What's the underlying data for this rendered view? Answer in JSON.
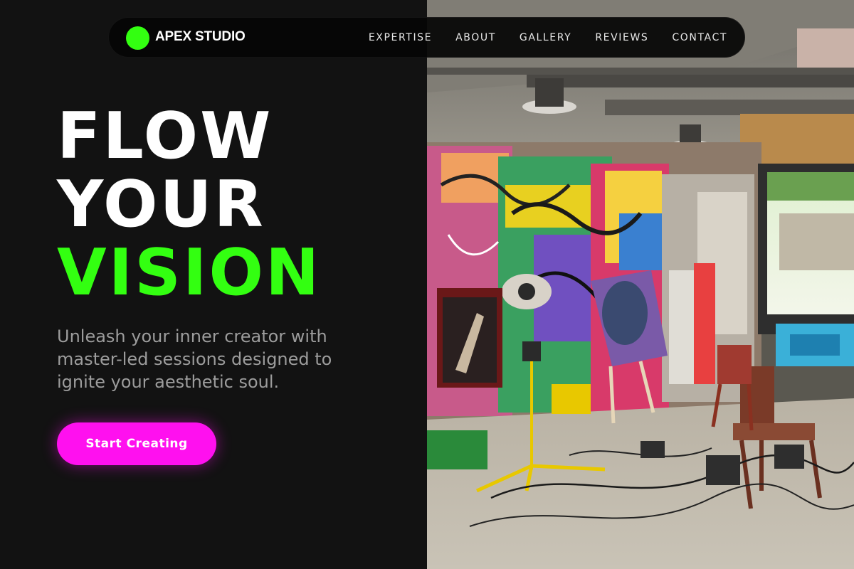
{
  "nav": {
    "brand": "APEX STUDIO",
    "links": [
      "EXPERTISE",
      "ABOUT",
      "GALLERY",
      "REVIEWS",
      "CONTACT"
    ]
  },
  "hero": {
    "lines": [
      "FLOW",
      "YOUR",
      "VISION"
    ],
    "subtitle": "Unleash your inner creator with master-led sessions designed to ignite your aesthetic soul.",
    "cta_label": "Start Creating"
  },
  "colors": {
    "background": "#121212",
    "accent_green": "#33ff11",
    "accent_magenta": "#ff10ef",
    "text_muted": "#9c9c9c"
  },
  "image": {
    "subject": "graffiti-covered art studio with easels, canvases, a chair and a work light"
  }
}
